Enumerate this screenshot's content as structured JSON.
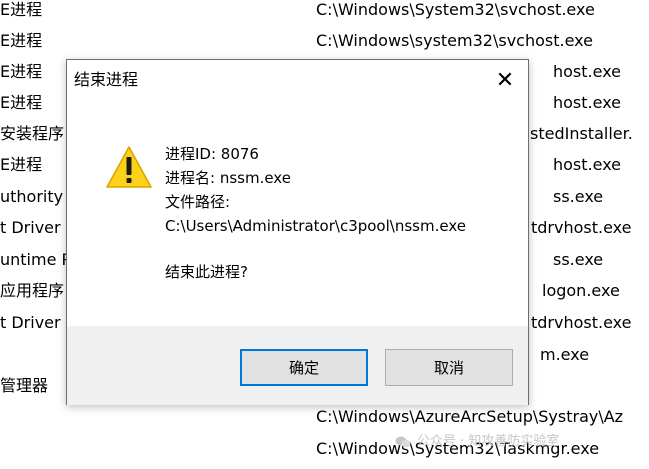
{
  "background_rows": [
    {
      "desc": "E进程",
      "path": "C:\\Windows\\System32\\svchost.exe"
    },
    {
      "desc": "E进程",
      "path": "C:\\Windows\\system32\\svchost.exe"
    },
    {
      "desc": "E进程",
      "path": "host.exe"
    },
    {
      "desc": "E进程",
      "path": "host.exe"
    },
    {
      "desc": "安装程序",
      "path": "stedInstaller."
    },
    {
      "desc": "E进程",
      "path": "host.exe"
    },
    {
      "desc": "uthority",
      "path": "ss.exe"
    },
    {
      "desc": "t Driver",
      "path": "tdrvhost.exe"
    },
    {
      "desc": "untime P",
      "path": "ss.exe"
    },
    {
      "desc": "应用程序",
      "path": "logon.exe"
    },
    {
      "desc": "t Driver",
      "path": "tdrvhost.exe"
    },
    {
      "desc": "",
      "path": "m.exe"
    },
    {
      "desc": "管理器",
      "path": ""
    },
    {
      "desc": "",
      "path": "C:\\Windows\\AzureArcSetup\\Systray\\Az"
    },
    {
      "desc": "",
      "path": "C:\\Windows\\System32\\Taskmgr.exe"
    }
  ],
  "dialog": {
    "title": "结束进程",
    "pid_line": "进程ID: 8076",
    "name_line": "进程名: nssm.exe",
    "path_label": "文件路径:",
    "path_value": "C:\\Users\\Administrator\\c3pool\\nssm.exe",
    "confirm_text": "结束此进程?",
    "ok_label": "确定",
    "cancel_label": "取消"
  },
  "watermark": "公众号 · 知攻善防实验室",
  "colors": {
    "warning_yellow": "#fcd116",
    "ok_border": "#0078d7",
    "footer_bg": "#f0f0f0"
  },
  "icons": {
    "warning": "warning-triangle-icon",
    "close": "close-icon"
  }
}
